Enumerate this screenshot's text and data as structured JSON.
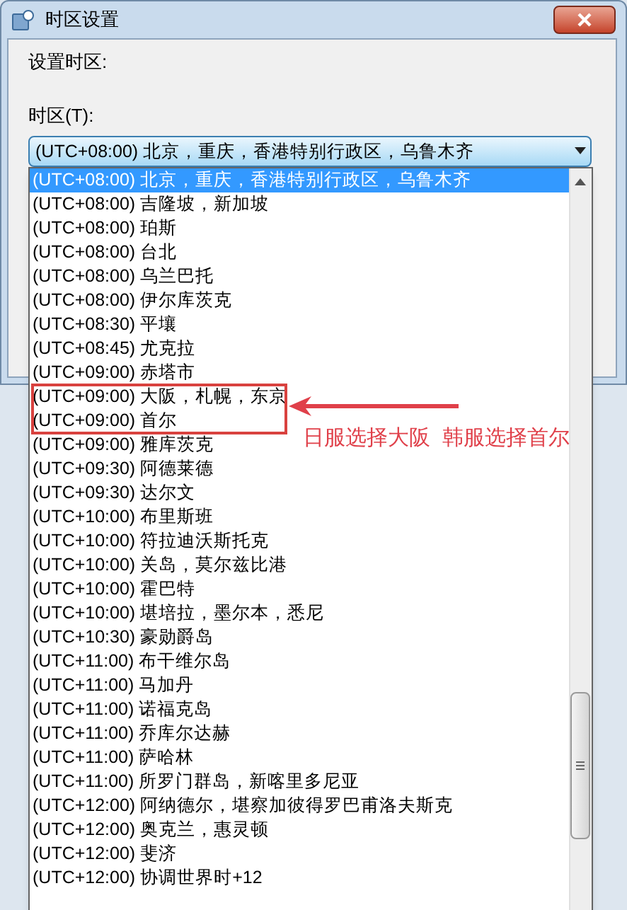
{
  "window": {
    "title": "时区设置"
  },
  "section_label": "设置时区:",
  "timezone": {
    "label": "时区(T):",
    "value": "(UTC+08:00) 北京，重庆，香港特别行政区，乌鲁木齐",
    "expanded": true
  },
  "options": [
    {
      "label": "(UTC+08:00) 北京，重庆，香港特别行政区，乌鲁木齐",
      "selected": true
    },
    {
      "label": "(UTC+08:00) 吉隆坡，新加坡",
      "selected": false
    },
    {
      "label": "(UTC+08:00) 珀斯",
      "selected": false
    },
    {
      "label": "(UTC+08:00) 台北",
      "selected": false
    },
    {
      "label": "(UTC+08:00) 乌兰巴托",
      "selected": false
    },
    {
      "label": "(UTC+08:00) 伊尔库茨克",
      "selected": false
    },
    {
      "label": "(UTC+08:30) 平壤",
      "selected": false
    },
    {
      "label": "(UTC+08:45) 尤克拉",
      "selected": false
    },
    {
      "label": "(UTC+09:00) 赤塔市",
      "selected": false
    },
    {
      "label": "(UTC+09:00) 大阪，札幌，东京",
      "selected": false
    },
    {
      "label": "(UTC+09:00) 首尔",
      "selected": false
    },
    {
      "label": "(UTC+09:00) 雅库茨克",
      "selected": false
    },
    {
      "label": "(UTC+09:30) 阿德莱德",
      "selected": false
    },
    {
      "label": "(UTC+09:30) 达尔文",
      "selected": false
    },
    {
      "label": "(UTC+10:00) 布里斯班",
      "selected": false
    },
    {
      "label": "(UTC+10:00) 符拉迪沃斯托克",
      "selected": false
    },
    {
      "label": "(UTC+10:00) 关岛，莫尔兹比港",
      "selected": false
    },
    {
      "label": "(UTC+10:00) 霍巴特",
      "selected": false
    },
    {
      "label": "(UTC+10:00) 堪培拉，墨尔本，悉尼",
      "selected": false
    },
    {
      "label": "(UTC+10:30) 豪勋爵岛",
      "selected": false
    },
    {
      "label": "(UTC+11:00) 布干维尔岛",
      "selected": false
    },
    {
      "label": "(UTC+11:00) 马加丹",
      "selected": false
    },
    {
      "label": "(UTC+11:00) 诺福克岛",
      "selected": false
    },
    {
      "label": "(UTC+11:00) 乔库尔达赫",
      "selected": false
    },
    {
      "label": "(UTC+11:00) 萨哈林",
      "selected": false
    },
    {
      "label": "(UTC+11:00) 所罗门群岛，新喀里多尼亚",
      "selected": false
    },
    {
      "label": "(UTC+12:00) 阿纳德尔，堪察加彼得罗巴甫洛夫斯克",
      "selected": false
    },
    {
      "label": "(UTC+12:00) 奥克兰，惠灵顿",
      "selected": false
    },
    {
      "label": "(UTC+12:00) 斐济",
      "selected": false
    },
    {
      "label": "(UTC+12:00) 协调世界时+12",
      "selected": false
    }
  ],
  "annotation": {
    "text": "日服选择大阪  韩服选择首尔"
  }
}
